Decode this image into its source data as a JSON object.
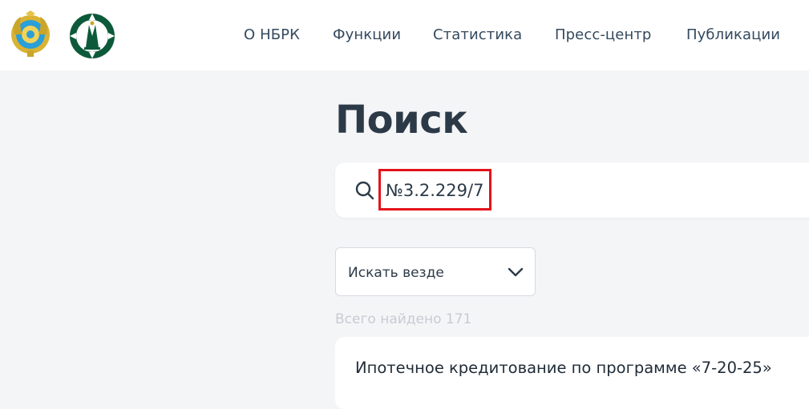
{
  "header": {
    "nav": [
      {
        "label": "О НБРК"
      },
      {
        "label": "Функции"
      },
      {
        "label": "Статистика"
      },
      {
        "label": "Пресс-центр"
      },
      {
        "label": "Публикации"
      }
    ]
  },
  "main": {
    "title": "Поиск",
    "search": {
      "value": "№3.2.229/7",
      "placeholder": ""
    },
    "scope_select": {
      "selected": "Искать везде"
    },
    "results_count": "Всего найдено 171",
    "results": [
      {
        "title": "Ипотечное кредитование по программе «7-20-25»"
      }
    ]
  },
  "colors": {
    "accent_highlight": "#e3131b",
    "logo_green": "#0d5a3a",
    "emblem_gold": "#d9b334",
    "emblem_blue": "#2a9fd8"
  }
}
